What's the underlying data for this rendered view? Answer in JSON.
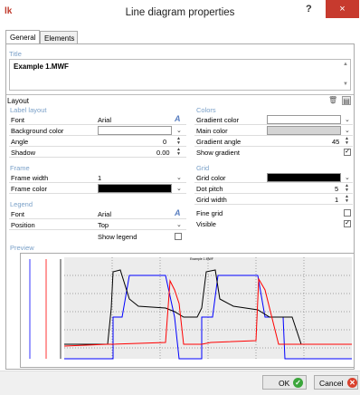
{
  "window": {
    "title": "Line diagram properties",
    "help": "?",
    "close": "×",
    "app_icon": "lk"
  },
  "tabs": [
    {
      "label": "General"
    },
    {
      "label": "Elements"
    }
  ],
  "title_group": {
    "label": "Title",
    "value": "Example 1.MWF"
  },
  "layout": {
    "header": "Layout",
    "label_layout": {
      "heading": "Label layout",
      "font_label": "Font",
      "font_value": "Arial",
      "bg_label": "Background color",
      "angle_label": "Angle",
      "angle_value": "0",
      "shadow_label": "Shadow",
      "shadow_value": "0.00"
    },
    "frame": {
      "heading": "Frame",
      "width_label": "Frame width",
      "width_value": "1",
      "color_label": "Frame color"
    },
    "legend": {
      "heading": "Legend",
      "font_label": "Font",
      "font_value": "Arial",
      "position_label": "Position",
      "position_value": "Top",
      "show_label": "Show legend"
    },
    "colors": {
      "heading": "Colors",
      "gradient_color_label": "Gradient color",
      "main_color_label": "Main color",
      "gradient_angle_label": "Gradient angle",
      "gradient_angle_value": "45",
      "show_gradient_label": "Show gradient"
    },
    "grid": {
      "heading": "Grid",
      "grid_color_label": "Grid color",
      "dot_pitch_label": "Dot pitch",
      "dot_pitch_value": "5",
      "grid_width_label": "Grid width",
      "grid_width_value": "1",
      "fine_grid_label": "Fine grid",
      "visible_label": "Visible"
    }
  },
  "preview": {
    "label": "Preview",
    "chart_title": "Example 1.MWF"
  },
  "footer": {
    "ok": "OK",
    "cancel": "Cancel"
  },
  "colors": {
    "accent": "#7aa0c8",
    "close": "#c73a2e",
    "ok_green": "#3ba63b",
    "cancel_red": "#d9412d",
    "series_black": "#000000",
    "series_blue": "#0000ff",
    "series_red": "#ff0000"
  },
  "icons": {
    "font_picker": "font-a-icon",
    "dropdown": "chevron-down-icon",
    "spinner": "spinner-icon"
  }
}
